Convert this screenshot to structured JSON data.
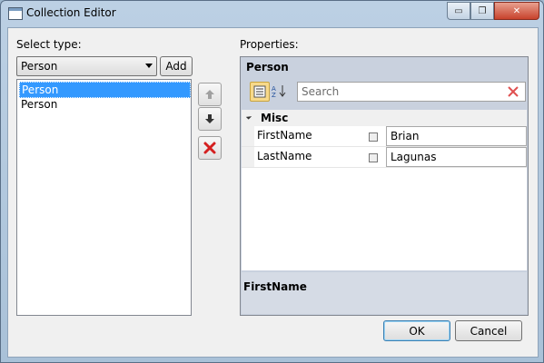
{
  "window": {
    "title": "Collection Editor",
    "minimize": "▭",
    "maximize": "❐",
    "close": "✕"
  },
  "left": {
    "select_type_label": "Select type:",
    "type_value": "Person",
    "add_label": "Add",
    "items": [
      "Person",
      "Person"
    ]
  },
  "right": {
    "properties_label": "Properties:",
    "object_title": "Person",
    "search_placeholder": "Search",
    "category": "Misc",
    "rows": [
      {
        "name": "FirstName",
        "value": "Brian"
      },
      {
        "name": "LastName",
        "value": "Lagunas"
      }
    ],
    "description_title": "FirstName"
  },
  "buttons": {
    "ok": "OK",
    "cancel": "Cancel"
  },
  "colors": {
    "selection": "#3399ff",
    "remove_red": "#d41f1f",
    "chrome": "#bcd0e4"
  }
}
